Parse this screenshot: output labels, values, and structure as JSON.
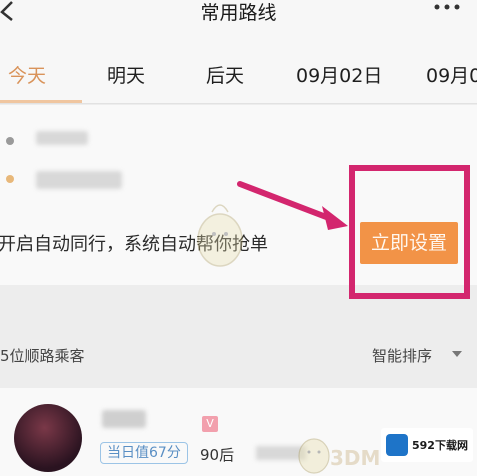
{
  "header": {
    "title": "常用路线",
    "back_icon": "chevron-left-icon",
    "more_icon": "more-dots-icon"
  },
  "tabs": [
    {
      "label": "今天",
      "active": true
    },
    {
      "label": "明天"
    },
    {
      "label": "后天"
    },
    {
      "label": "09月02日"
    },
    {
      "label": "09月0"
    }
  ],
  "route": {
    "hint": "开启自动同行，系统自动帮你抢单",
    "button_label": "立即设置",
    "start_dot_color": "#9a9a9a",
    "end_dot_color": "#e8b87a"
  },
  "passengers": {
    "count_label": "5位顺路乘客",
    "sort_label": "智能排序",
    "list": [
      {
        "score": "当日值67分",
        "age": "90后",
        "tag": "V"
      }
    ]
  },
  "watermark": {
    "site": "592下载网",
    "brand": "3DM"
  },
  "colors": {
    "accent": "#f29347",
    "highlight": "#d3266e",
    "active_tab": "#d9935a"
  }
}
